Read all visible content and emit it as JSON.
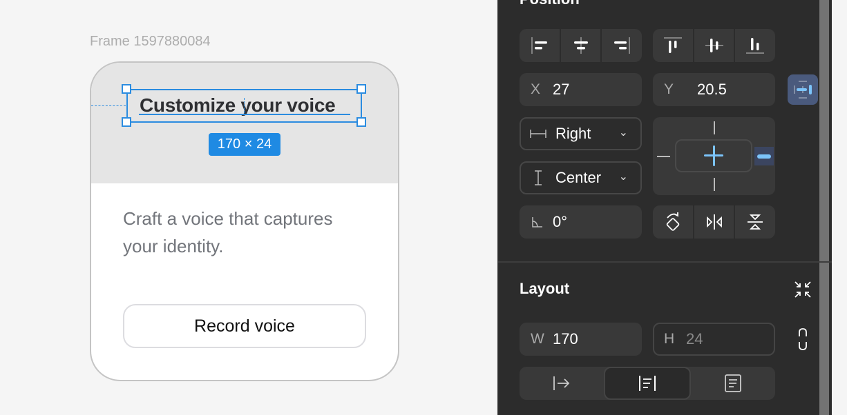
{
  "canvas": {
    "frame_label": "Frame 1597880084",
    "card": {
      "title": "Customize your voice",
      "description": "Craft a voice that captures your identity.",
      "button_label": "Record voice"
    },
    "selection": {
      "size_badge": "170 × 24"
    }
  },
  "panel": {
    "position": {
      "title": "Position",
      "horizontal_align_icons": [
        "align-left-icon",
        "align-horizontal-center-icon",
        "align-right-icon"
      ],
      "vertical_align_icons": [
        "align-top-icon",
        "align-vertical-center-icon",
        "align-bottom-icon"
      ],
      "x": {
        "label": "X",
        "value": "27"
      },
      "y": {
        "label": "Y",
        "value": "20.5"
      },
      "horizontal_constraint": {
        "value": "Right",
        "icon": "horizontal-constraint-icon"
      },
      "vertical_constraint": {
        "value": "Center",
        "icon": "vertical-constraint-icon"
      },
      "rotation": {
        "value": "0°",
        "icon": "angle-icon"
      },
      "transform_icons": [
        "rotate-icon",
        "flip-horizontal-icon",
        "flip-vertical-icon"
      ],
      "accent_color": "#7cc4fa"
    },
    "layout": {
      "title": "Layout",
      "w": {
        "label": "W",
        "value": "170"
      },
      "h": {
        "label": "H",
        "value": "24"
      },
      "resizing_icons": [
        "hug-width-icon",
        "fixed-width-icon",
        "auto-height-icon"
      ],
      "selected_resizing": 1
    }
  }
}
